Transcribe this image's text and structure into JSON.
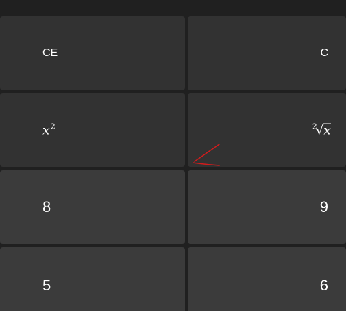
{
  "keypad": {
    "ce_label": "CE",
    "c_label": "C",
    "x_squared_base": "x",
    "x_squared_exp": "2",
    "cube_root_index": "2",
    "cube_root_radicand": "x",
    "key_8": "8",
    "key_9": "9",
    "key_5": "5",
    "key_6": "6"
  },
  "colors": {
    "background": "#202020",
    "function_key": "#323232",
    "number_key": "#3b3b3b",
    "text": "#ffffff",
    "annotation_arrow": "#d01c1c"
  }
}
